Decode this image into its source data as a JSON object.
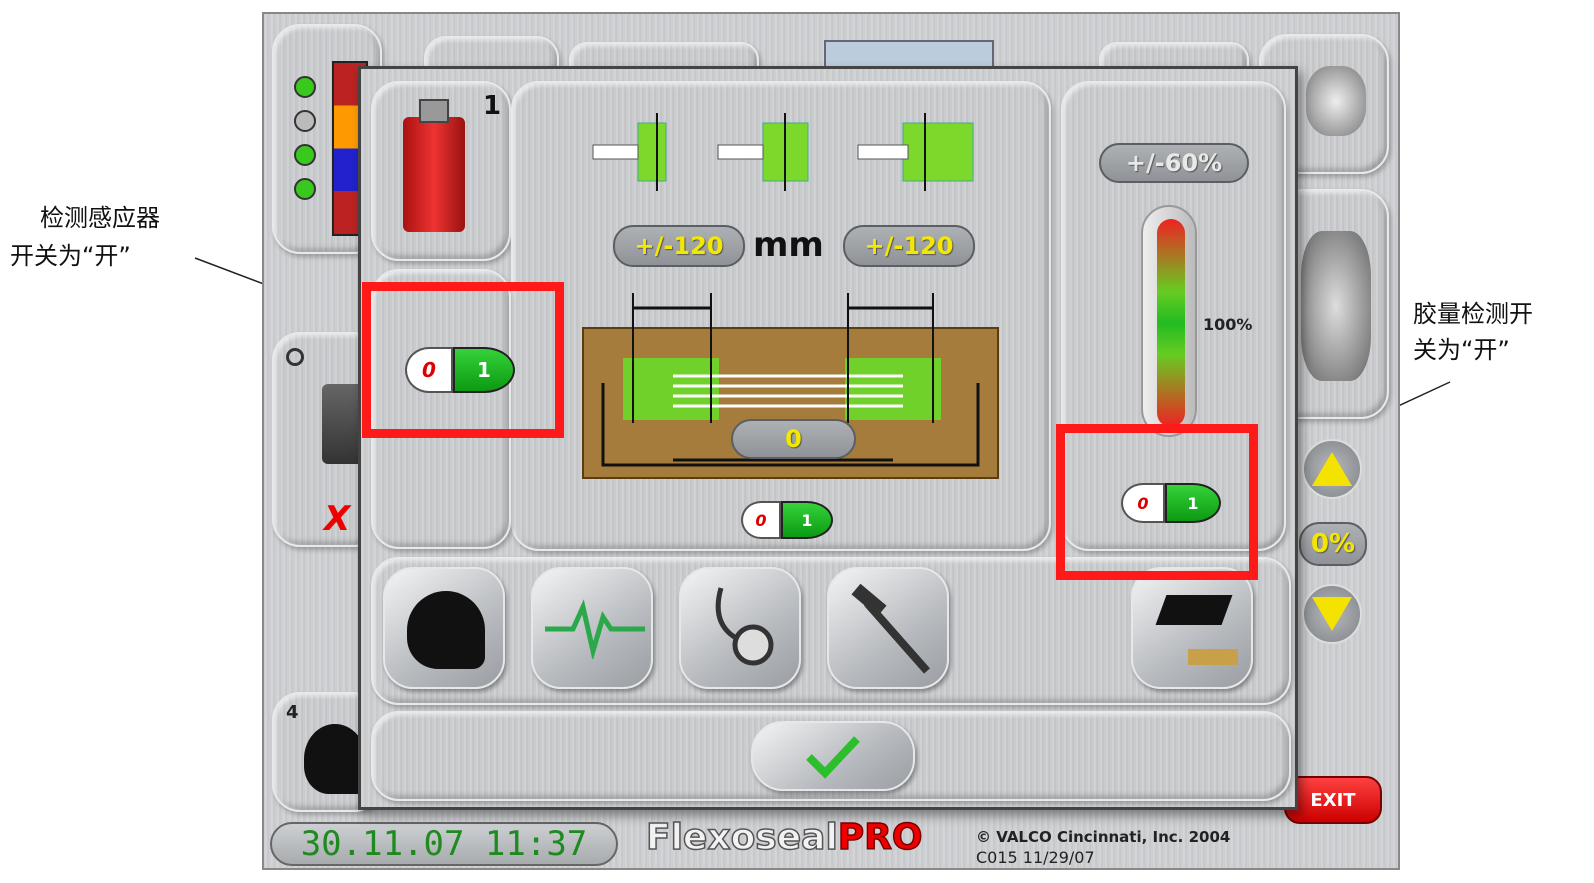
{
  "annotations": {
    "left_line1": "检测感应器",
    "left_line2": "开关为“开”",
    "right_line1": "胶量检测开",
    "right_line2": "关为“开”"
  },
  "sensor": {
    "number": "1"
  },
  "tolerance": {
    "left": "+/-120",
    "unit": "mm",
    "right": "+/-120",
    "center_value": "0"
  },
  "glue_meter": {
    "percent_range": "+/-60%",
    "scale_label": "100%"
  },
  "toggles": {
    "off_symbol": "0",
    "on_symbol": "1"
  },
  "side": {
    "counter": "4",
    "percent": "0%",
    "exit_label": "EXIT",
    "error_mark": "X"
  },
  "footer": {
    "datetime": "30.11.07 11:37",
    "brand": "Flexoseal",
    "brand_suffix": "PRO",
    "copyright": "© VALCO Cincinnati, Inc. 2004",
    "version": "C015 11/29/07"
  },
  "icons": {
    "sensor": "proximity-sensor-icon",
    "maintenance": "wrench-helmet-icon",
    "diagnostics": "heartbeat-icon",
    "inspection": "stethoscope-icon",
    "tools": "hammer-icon",
    "training": "graduation-cap-icon",
    "confirm": "checkmark-icon"
  },
  "colors": {
    "accent_green": "#6fd12a",
    "highlight_red": "#ff1a1a",
    "date_green": "#1f8a1f"
  }
}
